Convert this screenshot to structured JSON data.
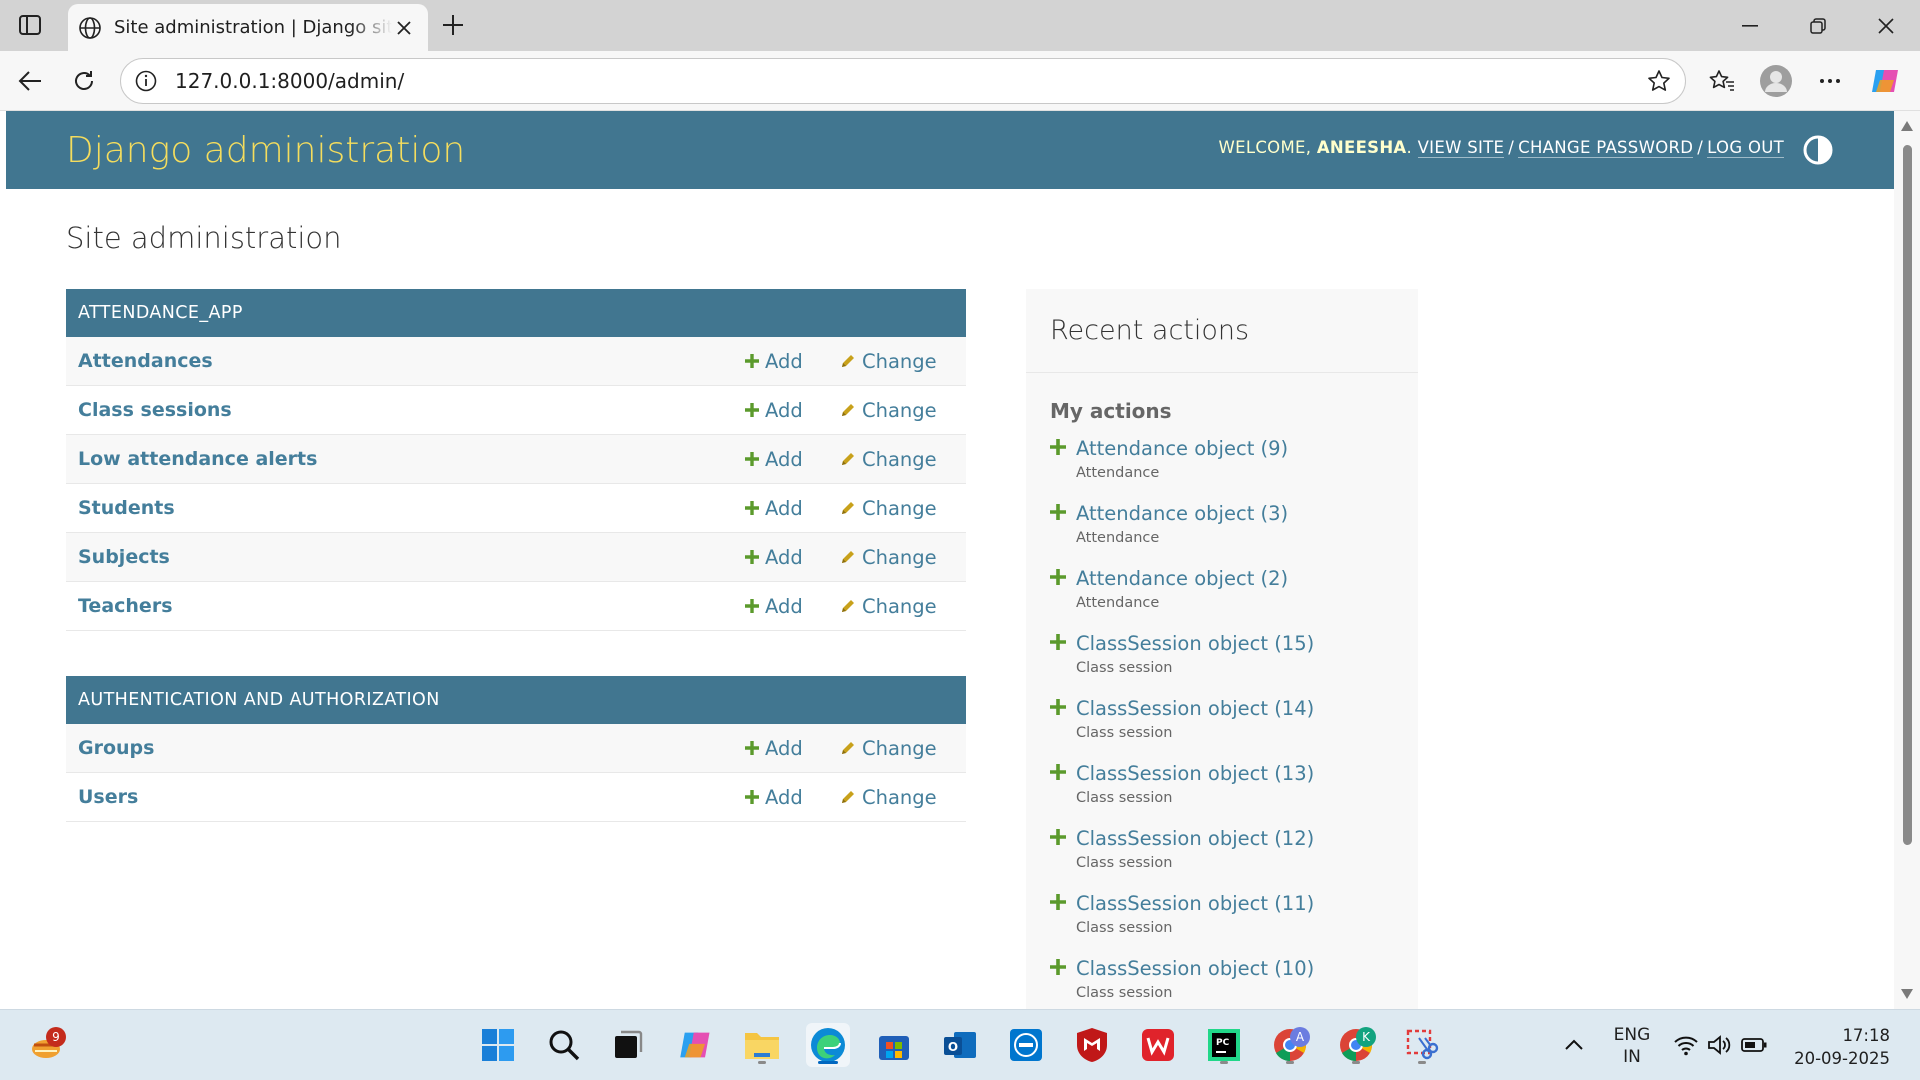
{
  "browser": {
    "tab_title": "Site administration | Django site admin",
    "url": "127.0.0.1:8000/admin/"
  },
  "header": {
    "branding": "Django administration",
    "welcome": "WELCOME,",
    "username": "ANEESHA",
    "view_site": "VIEW SITE",
    "change_password": "CHANGE PASSWORD",
    "log_out": "LOG OUT"
  },
  "page_title": "Site administration",
  "add_label": "Add",
  "change_label": "Change",
  "apps": [
    {
      "caption": "ATTENDANCE_APP",
      "models": [
        "Attendances",
        "Class sessions",
        "Low attendance alerts",
        "Students",
        "Subjects",
        "Teachers"
      ]
    },
    {
      "caption": "AUTHENTICATION AND AUTHORIZATION",
      "models": [
        "Groups",
        "Users"
      ]
    }
  ],
  "recent": {
    "title": "Recent actions",
    "my_actions": "My actions",
    "items": [
      {
        "label": "Attendance object (9)",
        "model": "Attendance"
      },
      {
        "label": "Attendance object (3)",
        "model": "Attendance"
      },
      {
        "label": "Attendance object (2)",
        "model": "Attendance"
      },
      {
        "label": "ClassSession object (15)",
        "model": "Class session"
      },
      {
        "label": "ClassSession object (14)",
        "model": "Class session"
      },
      {
        "label": "ClassSession object (13)",
        "model": "Class session"
      },
      {
        "label": "ClassSession object (12)",
        "model": "Class session"
      },
      {
        "label": "ClassSession object (11)",
        "model": "Class session"
      },
      {
        "label": "ClassSession object (10)",
        "model": "Class session"
      }
    ]
  },
  "taskbar": {
    "notification_count": "9",
    "lang_line1": "ENG",
    "lang_line2": "IN",
    "time": "17:18",
    "date": "20-09-2025",
    "chrome_profile_a": "A",
    "chrome_profile_k": "K"
  },
  "colors": {
    "header_bg": "#417690",
    "branding": "#f5dd5d",
    "link": "#447e9b",
    "add_green": "#5b9a2c",
    "change_yellow": "#c8a11b"
  }
}
